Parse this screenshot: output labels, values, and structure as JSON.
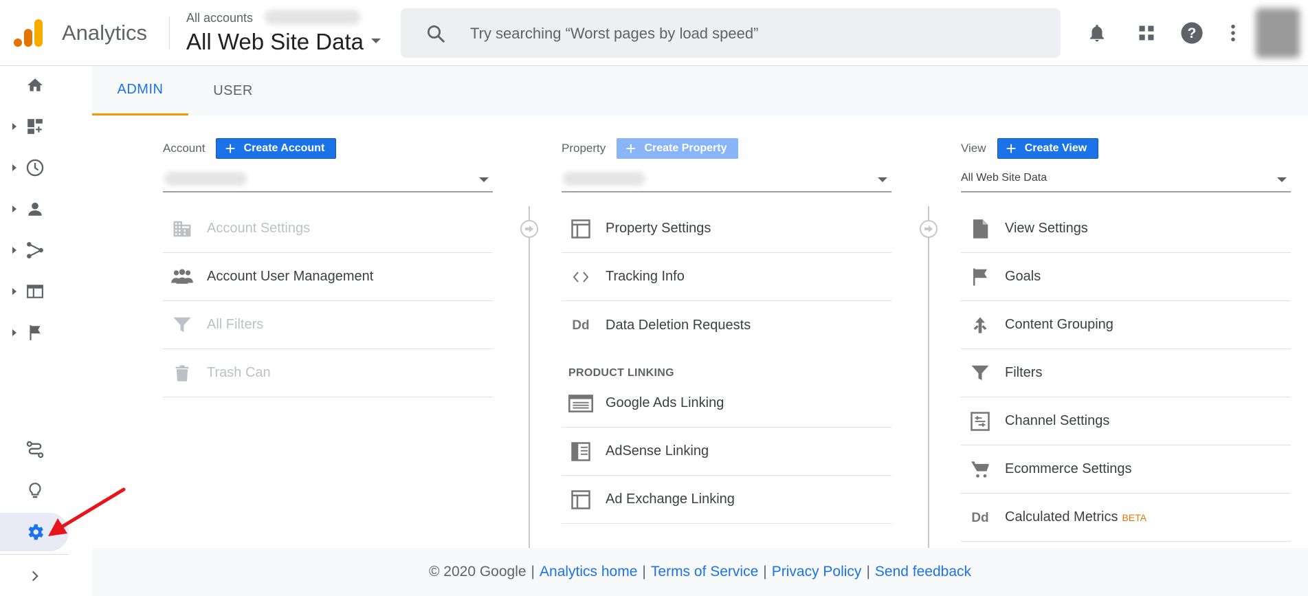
{
  "header": {
    "app_name": "Analytics",
    "account_small": "All accounts",
    "account_big": "All Web Site Data",
    "search_placeholder": "Try searching “Worst pages by load speed”",
    "icons": [
      "bell-icon",
      "apps-grid-icon",
      "help-icon",
      "more-vert-icon"
    ],
    "logo_colors": [
      "#f9ab00",
      "#e37400",
      "#e37400"
    ]
  },
  "left_nav": {
    "items": [
      "home-icon",
      "customization-icon",
      "realtime-icon",
      "audience-icon",
      "acquisition-icon",
      "behavior-icon",
      "conversions-icon",
      "attribution-icon",
      "discover-icon",
      "admin-gear-icon",
      "expand-icon"
    ]
  },
  "tabs": [
    {
      "label": "ADMIN",
      "active": true
    },
    {
      "label": "USER",
      "active": false
    }
  ],
  "columns": {
    "account": {
      "label": "Account",
      "button": "Create Account",
      "items": [
        {
          "label": "Account Settings",
          "icon": "building-icon",
          "enabled": false
        },
        {
          "label": "Account User Management",
          "icon": "users-icon",
          "enabled": true
        },
        {
          "label": "All Filters",
          "icon": "filter-icon",
          "enabled": false
        },
        {
          "label": "Trash Can",
          "icon": "trash-icon",
          "enabled": false
        }
      ]
    },
    "property": {
      "label": "Property",
      "button": "Create Property",
      "items": [
        {
          "label": "Property Settings",
          "icon": "layout-icon"
        },
        {
          "label": "Tracking Info",
          "icon": "code-icon"
        },
        {
          "label": "Data Deletion Requests",
          "icon": "dd-icon"
        }
      ],
      "section_title": "PRODUCT LINKING",
      "linking_items": [
        {
          "label": "Google Ads Linking",
          "icon": "ads-icon"
        },
        {
          "label": "AdSense Linking",
          "icon": "adsense-icon"
        },
        {
          "label": "Ad Exchange Linking",
          "icon": "adx-icon"
        }
      ]
    },
    "view": {
      "label": "View",
      "button": "Create View",
      "selected": "All Web Site Data",
      "items": [
        {
          "label": "View Settings",
          "icon": "document-icon"
        },
        {
          "label": "Goals",
          "icon": "flag-icon"
        },
        {
          "label": "Content Grouping",
          "icon": "grouping-icon"
        },
        {
          "label": "Filters",
          "icon": "filter-icon"
        },
        {
          "label": "Channel Settings",
          "icon": "channel-icon"
        },
        {
          "label": "Ecommerce Settings",
          "icon": "cart-icon"
        },
        {
          "label": "Calculated Metrics",
          "icon": "dd-icon",
          "badge": "BETA"
        }
      ]
    }
  },
  "footer": {
    "copyright": "© 2020 Google",
    "links": [
      "Analytics home",
      "Terms of Service",
      "Privacy Policy",
      "Send feedback"
    ]
  }
}
